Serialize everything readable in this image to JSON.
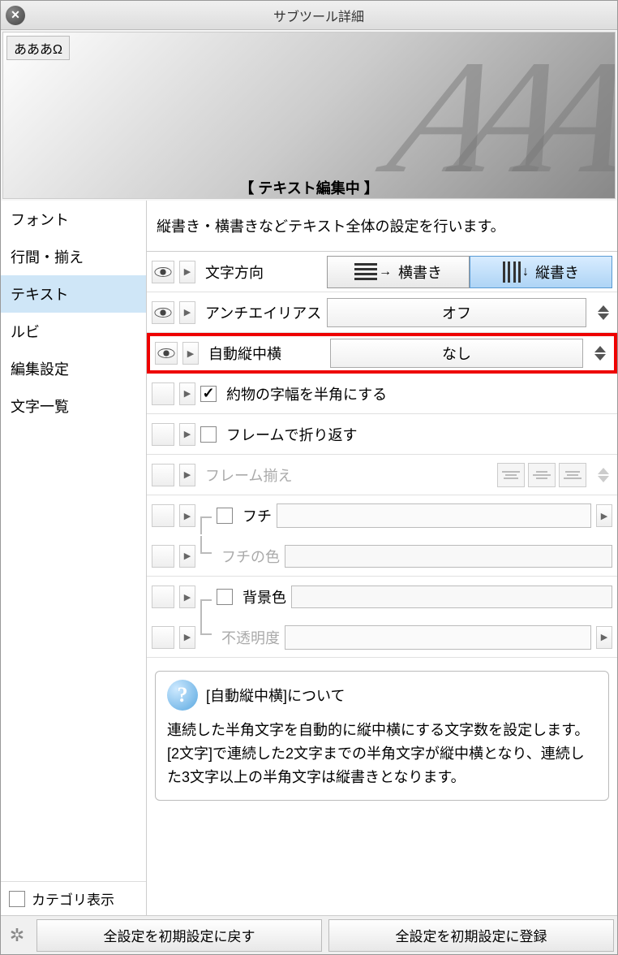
{
  "window": {
    "title": "サブツール詳細"
  },
  "preview": {
    "sample": "あああΩ",
    "banner": "【 テキスト編集中 】"
  },
  "sidebar": {
    "items": [
      {
        "label": "フォント"
      },
      {
        "label": "行間・揃え"
      },
      {
        "label": "テキスト"
      },
      {
        "label": "ルビ"
      },
      {
        "label": "編集設定"
      },
      {
        "label": "文字一覧"
      }
    ],
    "category_label": "カテゴリ表示"
  },
  "content": {
    "description": "縦書き・横書きなどテキスト全体の設定を行います。",
    "direction": {
      "label": "文字方向",
      "horizontal": "横書き",
      "vertical": "縦書き"
    },
    "antialias": {
      "label": "アンチエイリアス",
      "value": "オフ"
    },
    "tatechuyoko": {
      "label": "自動縦中横",
      "value": "なし"
    },
    "halfwidth": {
      "label": "約物の字幅を半角にする"
    },
    "framewrap": {
      "label": "フレームで折り返す"
    },
    "framealign": {
      "label": "フレーム揃え"
    },
    "border": {
      "label": "フチ"
    },
    "bordercolor": {
      "label": "フチの色"
    },
    "bgcolor": {
      "label": "背景色"
    },
    "opacity": {
      "label": "不透明度"
    }
  },
  "help": {
    "title": "[自動縦中横]について",
    "text": "連続した半角文字を自動的に縦中横にする文字数を設定します。[2文字]で連続した2文字までの半角文字が縦中横となり、連続した3文字以上の半角文字は縦書きとなります。"
  },
  "footer": {
    "reset": "全設定を初期設定に戻す",
    "register": "全設定を初期設定に登録"
  }
}
